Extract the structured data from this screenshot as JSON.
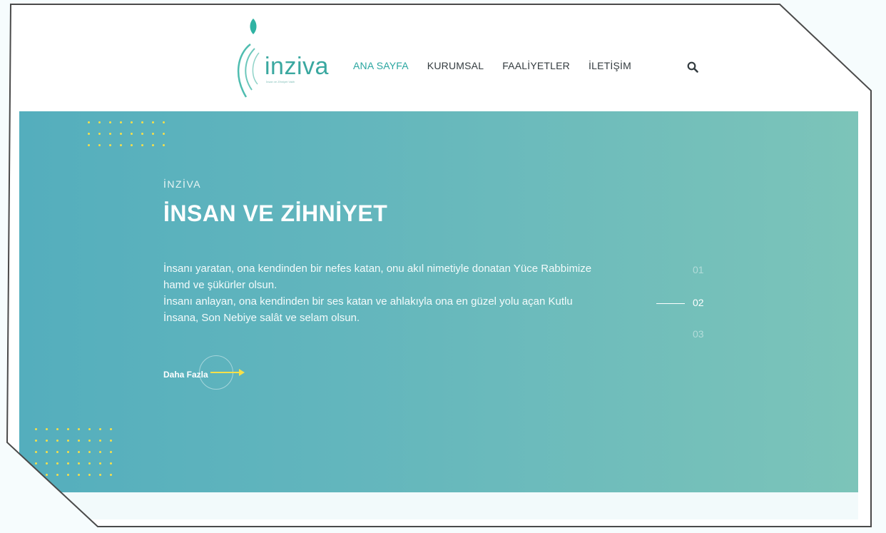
{
  "brand": {
    "name": "inziva",
    "tagline": "İnsan ve Zihniyet Vakfı",
    "accent_color": "#2aa6a0"
  },
  "nav": {
    "items": [
      {
        "label": "ANA SAYFA",
        "active": true
      },
      {
        "label": "KURUMSAL",
        "active": false
      },
      {
        "label": "FAALİYETLER",
        "active": false
      },
      {
        "label": "İLETİŞİM",
        "active": false
      }
    ],
    "search_icon": "search-icon"
  },
  "hero": {
    "eyebrow": "İNZİVA",
    "title": "İNSAN VE ZİHNİYET",
    "paragraph_1": "İnsanı yaratan, ona kendinden bir nefes katan, onu akıl nimetiyle donatan Yüce Rabbimize hamd ve şükürler olsun.",
    "paragraph_2": "İnsanı anlayan, ona kendinden bir ses katan ve ahlakıyla ona en güzel yolu açan Kutlu İnsana, Son Nebiye salât ve selam olsun.",
    "more_label": "Daha Fazla",
    "dot_color": "#f6e04a"
  },
  "slider": {
    "slides": [
      "01",
      "02",
      "03"
    ],
    "active_index": 1
  }
}
